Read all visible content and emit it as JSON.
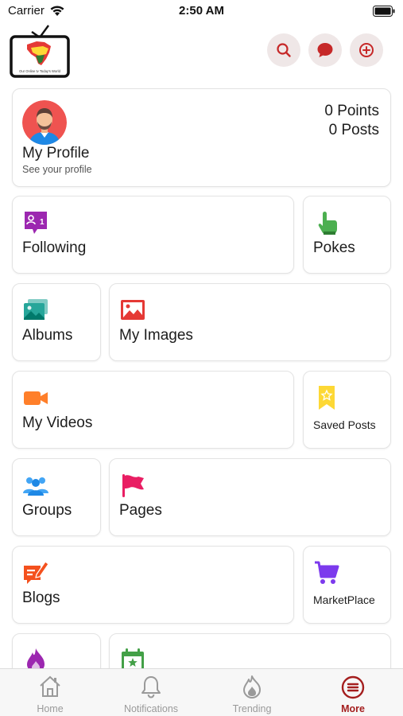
{
  "status_bar": {
    "carrier": "Carrier",
    "time": "2:50 AM"
  },
  "header": {
    "logo_tagline": "Our Online tv Today's World",
    "buttons": [
      {
        "name": "search",
        "icon": "search-icon"
      },
      {
        "name": "messages",
        "icon": "chat-bubble-icon"
      },
      {
        "name": "add",
        "icon": "plus-circle-icon"
      }
    ],
    "accent": "#c62828"
  },
  "profile": {
    "name": "My Profile",
    "subtitle": "See your profile",
    "points": "0 Points",
    "posts": "0 Posts"
  },
  "menu": {
    "following": "Following",
    "pokes": "Pokes",
    "albums": "Albums",
    "my_images": "My Images",
    "my_videos": "My Videos",
    "saved_posts": "Saved Posts",
    "groups": "Groups",
    "pages": "Pages",
    "blogs": "Blogs",
    "marketplace": "MarketPlace"
  },
  "tabbar": {
    "tabs": [
      {
        "label": "Home",
        "icon": "home-icon"
      },
      {
        "label": "Notifications",
        "icon": "bell-icon"
      },
      {
        "label": "Trending",
        "icon": "flame-icon"
      },
      {
        "label": "More",
        "icon": "menu-circle-icon",
        "active": true
      }
    ],
    "active_color": "#a41e1e"
  }
}
